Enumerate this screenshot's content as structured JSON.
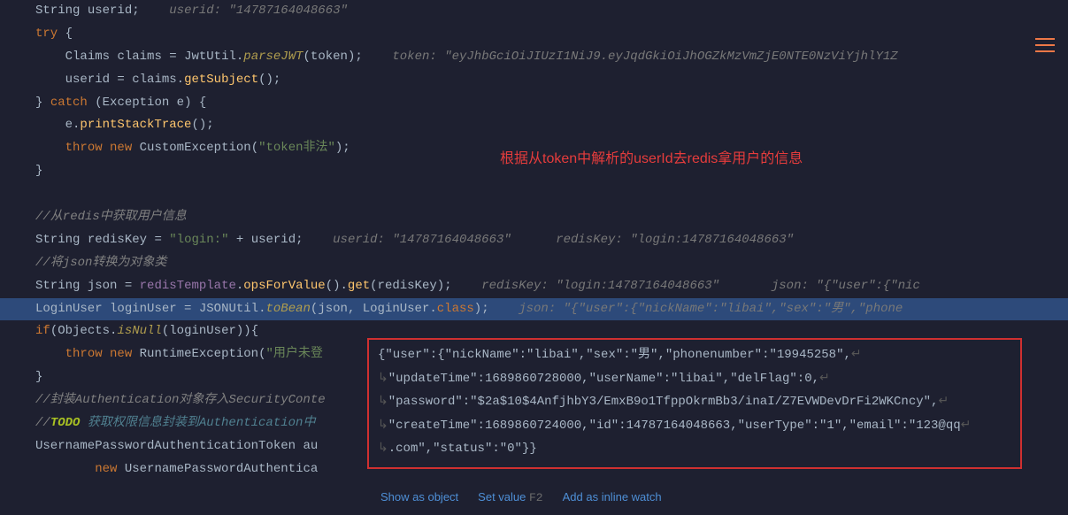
{
  "code": {
    "l1": {
      "type": "String",
      "var": "userid",
      "hint_label": "userid:",
      "hint_val": "\"14787164048663\""
    },
    "l2": {
      "kw": "try",
      "open": "{"
    },
    "l3": {
      "type": "Claims",
      "var": "claims",
      "cls": "JwtUtil",
      "method": "parseJWT",
      "arg": "token",
      "hint_label": "token:",
      "hint_val": "\"eyJhbGciOiJIUzI1NiJ9.eyJqdGkiOiJhOGZkMzVmZjE0NTE0NzViYjhlY1Z"
    },
    "l4": {
      "var": "userid",
      "obj": "claims",
      "method": "getSubject"
    },
    "l5": {
      "close": "}",
      "kw": "catch",
      "type": "Exception",
      "var": "e",
      "open": "{"
    },
    "l6": {
      "obj": "e",
      "method": "printStackTrace"
    },
    "l7": {
      "kw1": "throw",
      "kw2": "new",
      "cls": "CustomException",
      "arg": "\"token非法\""
    },
    "l8": {
      "close": "}"
    },
    "l9": {
      "comment": "//从redis中获取用户信息"
    },
    "l10": {
      "type": "String",
      "var": "redisKey",
      "str": "\"login:\"",
      "plus": "+",
      "var2": "userid",
      "hint1_label": "userid:",
      "hint1_val": "\"14787164048663\"",
      "hint2_label": "redisKey:",
      "hint2_val": "\"login:14787164048663\""
    },
    "l11": {
      "comment": "//将json转换为对象类"
    },
    "l12": {
      "type": "String",
      "var": "json",
      "field": "redisTemplate",
      "m1": "opsForValue",
      "m2": "get",
      "arg": "redisKey",
      "hint1_label": "redisKey:",
      "hint1_val": "\"login:14787164048663\"",
      "hint2_label": "json:",
      "hint2_val": "\"{\"user\":{\"nic"
    },
    "l13": {
      "type": "LoginUser",
      "var": "loginUser",
      "cls": "JSONUtil",
      "m": "toBean",
      "a1": "json",
      "a2": "LoginUser",
      "kw": "class",
      "hint_label": "json:",
      "hint_val": "\"{\"user\":{\"nickName\":\"libai\",\"sex\":\"男\",\"phone"
    },
    "l14": {
      "kw": "if",
      "cls": "Objects",
      "m": "isNull",
      "arg": "loginUser"
    },
    "l15": {
      "kw1": "throw",
      "kw2": "new",
      "cls": "RuntimeException",
      "str": "\"用户未登"
    },
    "l16": {
      "close": "}"
    },
    "l17": {
      "comment": "//封装Authentication对象存入SecurityConte"
    },
    "l18": {
      "comment_pre": "//",
      "todo": "TODO",
      "comment_post": " 获取权限信息封装到Authentication中"
    },
    "l19": {
      "type": "UsernamePasswordAuthenticationToken",
      "var": "au"
    },
    "l20": {
      "kw": "new",
      "cls": "UsernamePasswordAuthentica"
    }
  },
  "annotation": {
    "caption": "根据从token中解析的userId去redis拿用户的信息"
  },
  "tooltip": {
    "line1": "{\"user\":{\"nickName\":\"libai\",\"sex\":\"男\",\"phonenumber\":\"19945258\",",
    "line2": "\"updateTime\":1689860728000,\"userName\":\"libai\",\"delFlag\":0,",
    "line3": "\"password\":\"$2a$10$4AnfjhbY3/EmxB9o1TfppOkrmBb3/inaI/Z7EVWDevDrFi2WKCncy\",",
    "line4": "\"createTime\":1689860724000,\"id\":14787164048663,\"userType\":\"1\",\"email\":\"123@qq",
    "line5": ".com\",\"status\":\"0\"}}"
  },
  "actions": {
    "show_obj": "Show as object",
    "set_val": "Set value",
    "set_val_key": "F2",
    "add_watch": "Add as inline watch"
  }
}
